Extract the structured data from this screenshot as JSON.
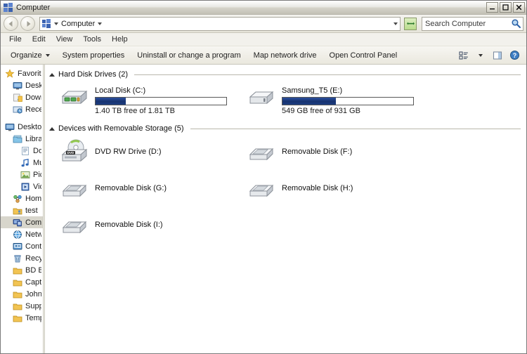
{
  "window": {
    "title": "Computer",
    "controls": {
      "minimize": "–",
      "maximize": "☐",
      "close": "✕"
    }
  },
  "address": {
    "back_tooltip": "Back",
    "forward_tooltip": "Forward",
    "crumb": "Computer",
    "refresh_tooltip": "Refresh"
  },
  "search": {
    "placeholder": "Search Computer",
    "value": ""
  },
  "menu": {
    "items": [
      "File",
      "Edit",
      "View",
      "Tools",
      "Help"
    ]
  },
  "toolbar": {
    "organize": "Organize",
    "system_properties": "System properties",
    "uninstall": "Uninstall or change a program",
    "map_network": "Map network drive",
    "open_control_panel": "Open Control Panel"
  },
  "navpane": {
    "items": [
      {
        "label": "Favorites",
        "icon": "star-icon",
        "level": 0,
        "selected": false,
        "gap_after": false
      },
      {
        "label": "Desktop",
        "icon": "desktop-icon",
        "level": 1,
        "selected": false,
        "gap_after": false
      },
      {
        "label": "Downloads",
        "icon": "downloads-icon",
        "level": 1,
        "selected": false,
        "gap_after": false
      },
      {
        "label": "Recent Places",
        "icon": "recent-places-icon",
        "level": 1,
        "selected": false,
        "gap_after": true
      },
      {
        "label": "Desktop",
        "icon": "desktop-icon",
        "level": 0,
        "selected": false,
        "gap_after": false
      },
      {
        "label": "Libraries",
        "icon": "libraries-icon",
        "level": 1,
        "selected": false,
        "gap_after": false
      },
      {
        "label": "Documents",
        "icon": "documents-icon",
        "level": 2,
        "selected": false,
        "gap_after": false
      },
      {
        "label": "Music",
        "icon": "music-icon",
        "level": 2,
        "selected": false,
        "gap_after": false
      },
      {
        "label": "Pictures",
        "icon": "pictures-icon",
        "level": 2,
        "selected": false,
        "gap_after": false
      },
      {
        "label": "Videos",
        "icon": "videos-icon",
        "level": 2,
        "selected": false,
        "gap_after": false
      },
      {
        "label": "Homegroup",
        "icon": "homegroup-icon",
        "level": 1,
        "selected": false,
        "gap_after": false
      },
      {
        "label": "test",
        "icon": "user-folder-icon",
        "level": 1,
        "selected": false,
        "gap_after": false
      },
      {
        "label": "Computer",
        "icon": "computer-icon",
        "level": 1,
        "selected": true,
        "gap_after": false
      },
      {
        "label": "Network",
        "icon": "network-icon",
        "level": 1,
        "selected": false,
        "gap_after": false
      },
      {
        "label": "Control Panel",
        "icon": "control-panel-icon",
        "level": 1,
        "selected": false,
        "gap_after": false
      },
      {
        "label": "Recycle Bin",
        "icon": "recycle-bin-icon",
        "level": 1,
        "selected": false,
        "gap_after": false
      },
      {
        "label": "BD Backup",
        "icon": "folder-icon",
        "level": 1,
        "selected": false,
        "gap_after": false
      },
      {
        "label": "Capture",
        "icon": "folder-icon",
        "level": 1,
        "selected": false,
        "gap_after": false
      },
      {
        "label": "John",
        "icon": "folder-icon",
        "level": 1,
        "selected": false,
        "gap_after": false
      },
      {
        "label": "Support",
        "icon": "folder-icon",
        "level": 1,
        "selected": false,
        "gap_after": false
      },
      {
        "label": "Temp",
        "icon": "folder-icon",
        "level": 1,
        "selected": false,
        "gap_after": false
      }
    ]
  },
  "content": {
    "groups": [
      {
        "title": "Hard Disk Drives (2)",
        "expanded": true,
        "items": [
          {
            "name": "Local Disk (C:)",
            "icon": "hard-disk-icon",
            "sub": "1.40 TB free of 1.81 TB",
            "has_bar": true,
            "used_percent": 23
          },
          {
            "name": "Samsung_T5 (E:)",
            "icon": "external-drive-icon",
            "sub": "549 GB free of 931 GB",
            "has_bar": true,
            "used_percent": 41
          }
        ]
      },
      {
        "title": "Devices with Removable Storage (5)",
        "expanded": true,
        "items": [
          {
            "name": "DVD RW Drive (D:)",
            "icon": "dvd-drive-icon",
            "sub": "",
            "has_bar": false,
            "used_percent": 0
          },
          {
            "name": "Removable Disk (F:)",
            "icon": "removable-disk-icon",
            "sub": "",
            "has_bar": false,
            "used_percent": 0
          },
          {
            "name": "Removable Disk (G:)",
            "icon": "removable-disk-icon",
            "sub": "",
            "has_bar": false,
            "used_percent": 0
          },
          {
            "name": "Removable Disk (H:)",
            "icon": "removable-disk-icon",
            "sub": "",
            "has_bar": false,
            "used_percent": 0
          },
          {
            "name": "Removable Disk (I:)",
            "icon": "removable-disk-icon",
            "sub": "",
            "has_bar": false,
            "used_percent": 0
          }
        ]
      }
    ]
  },
  "colors": {
    "bar_fill": "#1d3d82",
    "selection": "#d8d6cc",
    "folder_yellow": "#e8b94a",
    "title_gradient_end": "#c3c1b6"
  }
}
